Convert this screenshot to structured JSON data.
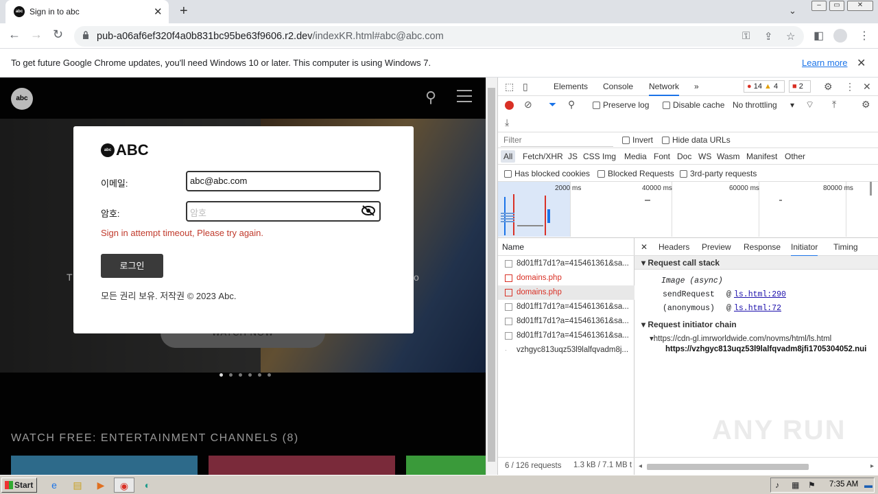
{
  "browser": {
    "tab_title": "Sign in to abc",
    "favicon_text": "abc",
    "url_main": "pub-a06af6ef320f4a0b831bc95be63f9606.r2.dev",
    "url_rest": "/indexKR.html#abc@abc.com",
    "new_tab": "+",
    "close_tab": "✕"
  },
  "infobar": {
    "message": "To get future Google Chrome updates, you'll need Windows 10 or later. This computer is using Windows 7.",
    "link": "Learn more",
    "close": "✕"
  },
  "page": {
    "logo_text": "abc",
    "hero_left_char": "T",
    "hero_right_char": "o",
    "watch_now": "WATCH NOW",
    "channels_title": "WATCH FREE: ENTERTAINMENT CHANNELS (8)"
  },
  "dialog": {
    "brand": "ABC",
    "brand_circle": "abc",
    "email_label": "이메일:",
    "email_value": "abc@abc.com",
    "password_label": "암호:",
    "password_placeholder": "암호",
    "error": "Sign in attempt timeout, Please try again.",
    "login_button": "로그인",
    "copyright": "모든 권리 보유. 저작권 © 2023 Abc."
  },
  "devtools": {
    "tabs": [
      "Elements",
      "Console",
      "Network"
    ],
    "more": "»",
    "errors": "14",
    "warnings": "4",
    "issues": "2",
    "preserve_log": "Preserve log",
    "disable_cache": "Disable cache",
    "throttling": "No throttling",
    "filter_placeholder": "Filter",
    "invert": "Invert",
    "hide_data_urls": "Hide data URLs",
    "filter_types": [
      "All",
      "Fetch/XHR",
      "JS",
      "CSS",
      "Img",
      "Media",
      "Font",
      "Doc",
      "WS",
      "Wasm",
      "Manifest",
      "Other"
    ],
    "has_blocked_cookies": "Has blocked cookies",
    "blocked_requests": "Blocked Requests",
    "third_party": "3rd-party requests",
    "timeline_labels": [
      "2000 ms",
      "40000 ms",
      "60000 ms",
      "80000 ms"
    ],
    "name_header": "Name",
    "requests": [
      {
        "name": "8d01ff17d1?a=415461361&sa...",
        "error": false,
        "selected": false
      },
      {
        "name": "domains.php",
        "error": true,
        "selected": false
      },
      {
        "name": "domains.php",
        "error": true,
        "selected": true
      },
      {
        "name": "8d01ff17d1?a=415461361&sa...",
        "error": false,
        "selected": false
      },
      {
        "name": "8d01ff17d1?a=415461361&sa...",
        "error": false,
        "selected": false
      },
      {
        "name": "8d01ff17d1?a=415461361&sa...",
        "error": false,
        "selected": false
      },
      {
        "name": "vzhgyc813uqz53l9lalfqvadm8j...",
        "error": false,
        "selected": false
      }
    ],
    "status": "6 / 126 requests",
    "transfer": "1.3 kB / 7.1 MB t",
    "detail_tabs": [
      "Headers",
      "Preview",
      "Response",
      "Initiator",
      "Timing"
    ],
    "call_stack_title": "Request call stack",
    "stack": [
      {
        "fn": "Image (async)",
        "loc": ""
      },
      {
        "fn": "sendRequest",
        "loc": "ls.html:290"
      },
      {
        "fn": "(anonymous)",
        "loc": "ls.html:72"
      }
    ],
    "chain_title": "Request initiator chain",
    "chain_1": "https://cdn-gl.imrworldwide.com/novms/html/ls.html",
    "chain_2": "https://vzhgyc813uqz53l9lalfqvadm8jfi1705304052.nui"
  },
  "taskbar": {
    "start": "Start",
    "clock": "7:35 AM"
  },
  "watermark": "ANY RUN"
}
